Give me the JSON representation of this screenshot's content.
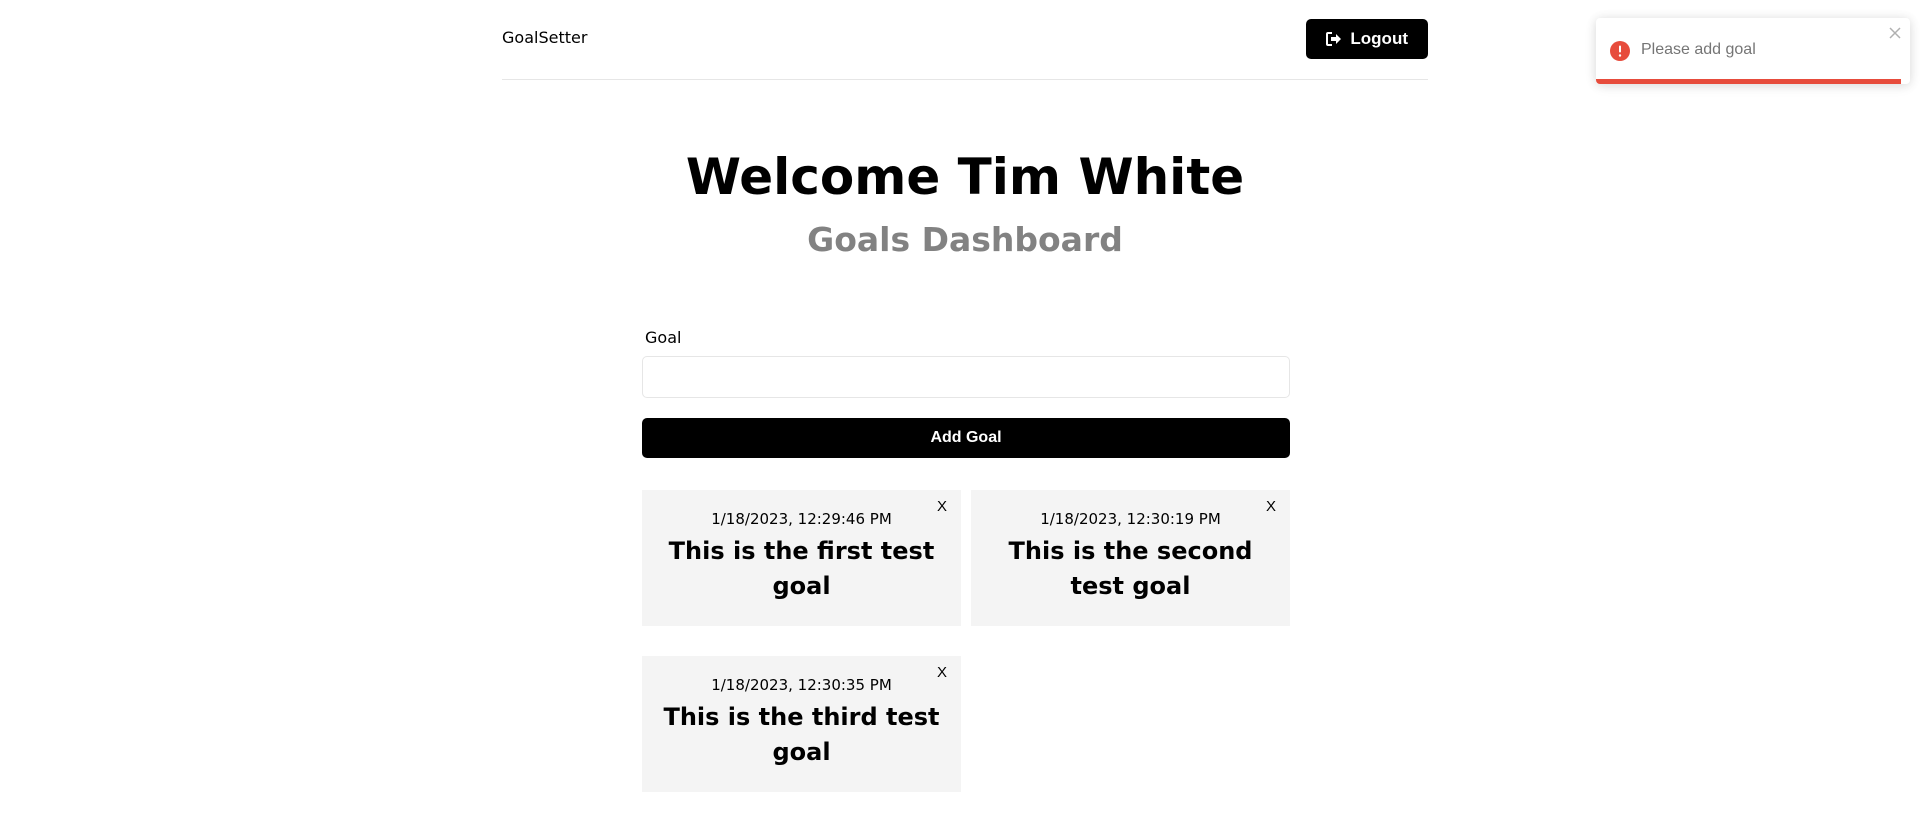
{
  "header": {
    "brand": "GoalSetter",
    "logout_label": "Logout"
  },
  "heading": {
    "welcome": "Welcome Tim White",
    "subtitle": "Goals Dashboard"
  },
  "form": {
    "label": "Goal",
    "input_value": "",
    "submit_label": "Add Goal"
  },
  "goals": [
    {
      "date": "1/18/2023, 12:29:46 PM",
      "text": "This is the first test goal",
      "delete_label": "X"
    },
    {
      "date": "1/18/2023, 12:30:19 PM",
      "text": "This is the second test goal",
      "delete_label": "X"
    },
    {
      "date": "1/18/2023, 12:30:35 PM",
      "text": "This is the third test goal",
      "delete_label": "X"
    }
  ],
  "toast": {
    "message": "Please add goal",
    "type": "error",
    "progress_percent": 97,
    "color": "#e74c3c"
  },
  "icons": {
    "logout": "logout-icon",
    "error": "error-icon",
    "close": "close-icon"
  }
}
